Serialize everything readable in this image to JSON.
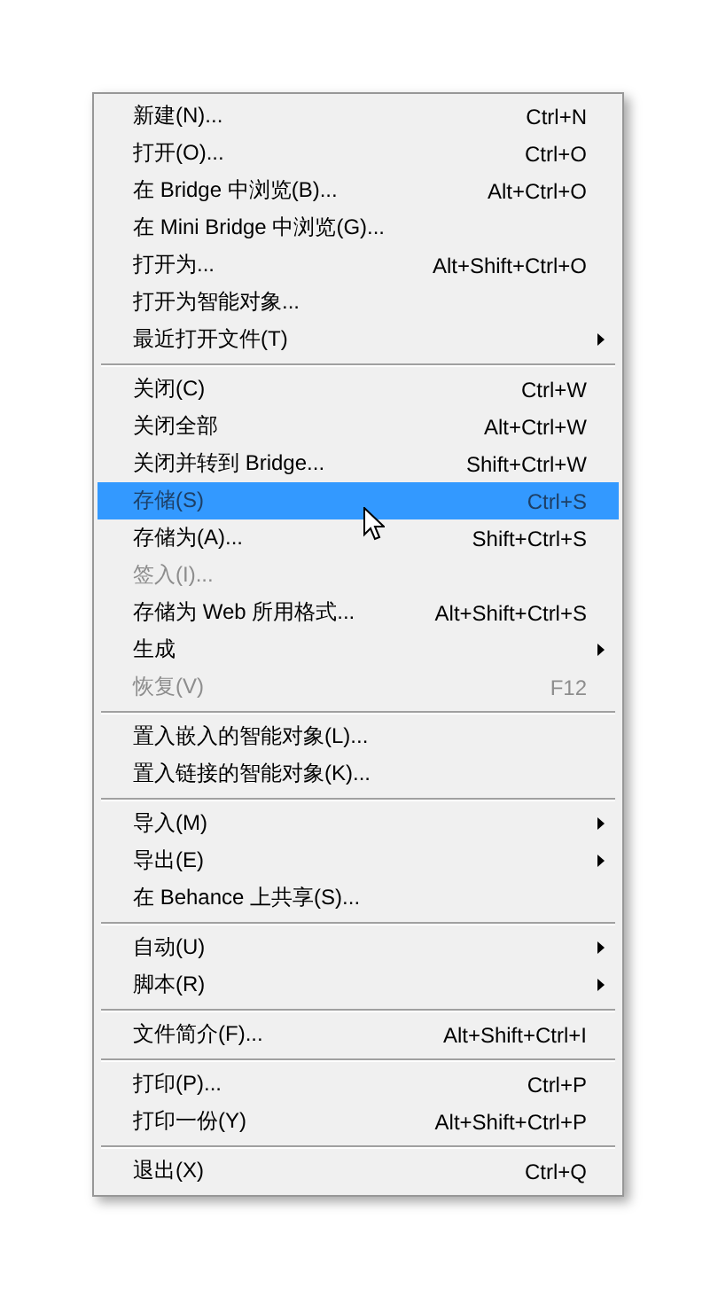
{
  "menu": {
    "groups": [
      {
        "items": [
          {
            "label": "新建(N)...",
            "shortcut": "Ctrl+N",
            "disabled": false,
            "selected": false,
            "submenu": false
          },
          {
            "label": "打开(O)...",
            "shortcut": "Ctrl+O",
            "disabled": false,
            "selected": false,
            "submenu": false
          },
          {
            "label": "在 Bridge 中浏览(B)...",
            "shortcut": "Alt+Ctrl+O",
            "disabled": false,
            "selected": false,
            "submenu": false
          },
          {
            "label": "在 Mini Bridge 中浏览(G)...",
            "disabled": false,
            "selected": false,
            "submenu": false
          },
          {
            "label": "打开为...",
            "shortcut": "Alt+Shift+Ctrl+O",
            "disabled": false,
            "selected": false,
            "submenu": false
          },
          {
            "label": "打开为智能对象...",
            "disabled": false,
            "selected": false,
            "submenu": false
          },
          {
            "label": "最近打开文件(T)",
            "disabled": false,
            "selected": false,
            "submenu": true
          }
        ]
      },
      {
        "items": [
          {
            "label": "关闭(C)",
            "shortcut": "Ctrl+W",
            "disabled": false,
            "selected": false,
            "submenu": false
          },
          {
            "label": "关闭全部",
            "shortcut": "Alt+Ctrl+W",
            "disabled": false,
            "selected": false,
            "submenu": false
          },
          {
            "label": "关闭并转到 Bridge...",
            "shortcut": "Shift+Ctrl+W",
            "disabled": false,
            "selected": false,
            "submenu": false
          },
          {
            "label": "存储(S)",
            "shortcut": "Ctrl+S",
            "disabled": true,
            "selected": true,
            "submenu": false
          },
          {
            "label": "存储为(A)...",
            "shortcut": "Shift+Ctrl+S",
            "disabled": false,
            "selected": false,
            "submenu": false
          },
          {
            "label": "签入(I)...",
            "disabled": true,
            "selected": false,
            "submenu": false
          },
          {
            "label": "存储为 Web 所用格式...",
            "shortcut": "Alt+Shift+Ctrl+S",
            "disabled": false,
            "selected": false,
            "submenu": false
          },
          {
            "label": "生成",
            "disabled": false,
            "selected": false,
            "submenu": true
          },
          {
            "label": "恢复(V)",
            "shortcut": "F12",
            "disabled": true,
            "selected": false,
            "submenu": false
          }
        ]
      },
      {
        "items": [
          {
            "label": "置入嵌入的智能对象(L)...",
            "disabled": false,
            "selected": false,
            "submenu": false
          },
          {
            "label": "置入链接的智能对象(K)...",
            "disabled": false,
            "selected": false,
            "submenu": false
          }
        ]
      },
      {
        "items": [
          {
            "label": "导入(M)",
            "disabled": false,
            "selected": false,
            "submenu": true
          },
          {
            "label": "导出(E)",
            "disabled": false,
            "selected": false,
            "submenu": true
          },
          {
            "label": "在 Behance 上共享(S)...",
            "disabled": false,
            "selected": false,
            "submenu": false
          }
        ]
      },
      {
        "items": [
          {
            "label": "自动(U)",
            "disabled": false,
            "selected": false,
            "submenu": true
          },
          {
            "label": "脚本(R)",
            "disabled": false,
            "selected": false,
            "submenu": true
          }
        ]
      },
      {
        "items": [
          {
            "label": "文件简介(F)...",
            "shortcut": "Alt+Shift+Ctrl+I",
            "disabled": false,
            "selected": false,
            "submenu": false
          }
        ]
      },
      {
        "items": [
          {
            "label": "打印(P)...",
            "shortcut": "Ctrl+P",
            "disabled": false,
            "selected": false,
            "submenu": false
          },
          {
            "label": "打印一份(Y)",
            "shortcut": "Alt+Shift+Ctrl+P",
            "disabled": false,
            "selected": false,
            "submenu": false
          }
        ]
      },
      {
        "items": [
          {
            "label": "退出(X)",
            "shortcut": "Ctrl+Q",
            "disabled": false,
            "selected": false,
            "submenu": false
          }
        ]
      }
    ]
  }
}
